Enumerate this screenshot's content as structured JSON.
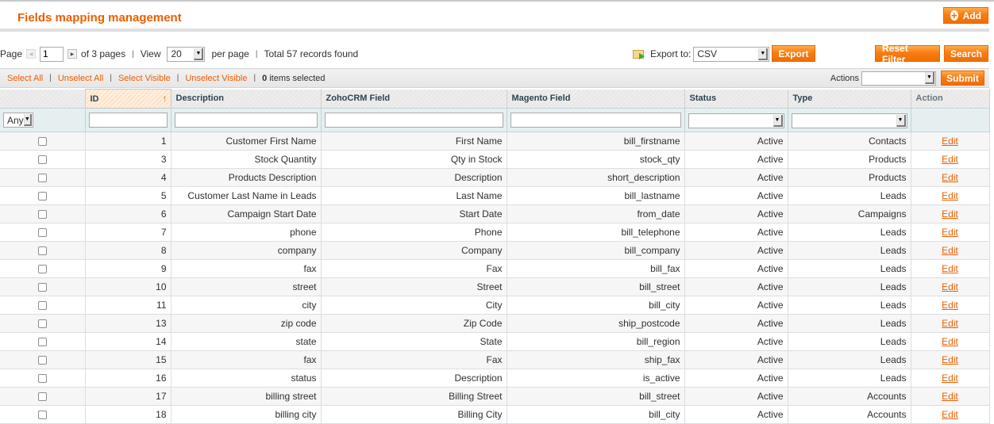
{
  "header": {
    "title": "Fields mapping management",
    "add_label": "Add"
  },
  "pager": {
    "page_label": "Page",
    "current_page": "1",
    "of_pages": "of 3 pages",
    "view_label": "View",
    "per_page_value": "20",
    "per_page_label": "per page",
    "total": "Total 57 records found"
  },
  "export": {
    "label": "Export to:",
    "format": "CSV",
    "button": "Export"
  },
  "filters": {
    "reset_label": "Reset Filter",
    "search_label": "Search"
  },
  "massaction": {
    "select_all": "Select All",
    "unselect_all": "Unselect All",
    "select_visible": "Select Visible",
    "unselect_visible": "Unselect Visible",
    "count": "0",
    "selected_text": "items selected",
    "actions_label": "Actions",
    "actions_value": "",
    "submit_label": "Submit"
  },
  "grid": {
    "columns": [
      "ID",
      "Description",
      "ZohoCRM Field",
      "Magento Field",
      "Status",
      "Type",
      "Action"
    ],
    "checkbox_filter": "Any",
    "rows": [
      {
        "id": "1",
        "description": "Customer First Name",
        "zoho": "First Name",
        "magento": "bill_firstname",
        "status": "Active",
        "type": "Contacts",
        "action": "Edit"
      },
      {
        "id": "3",
        "description": "Stock Quantity",
        "zoho": "Qty in Stock",
        "magento": "stock_qty",
        "status": "Active",
        "type": "Products",
        "action": "Edit"
      },
      {
        "id": "4",
        "description": "Products Description",
        "zoho": "Description",
        "magento": "short_description",
        "status": "Active",
        "type": "Products",
        "action": "Edit"
      },
      {
        "id": "5",
        "description": "Customer Last Name in Leads",
        "zoho": "Last Name",
        "magento": "bill_lastname",
        "status": "Active",
        "type": "Leads",
        "action": "Edit"
      },
      {
        "id": "6",
        "description": "Campaign Start Date",
        "zoho": "Start Date",
        "magento": "from_date",
        "status": "Active",
        "type": "Campaigns",
        "action": "Edit"
      },
      {
        "id": "7",
        "description": "phone",
        "zoho": "Phone",
        "magento": "bill_telephone",
        "status": "Active",
        "type": "Leads",
        "action": "Edit"
      },
      {
        "id": "8",
        "description": "company",
        "zoho": "Company",
        "magento": "bill_company",
        "status": "Active",
        "type": "Leads",
        "action": "Edit"
      },
      {
        "id": "9",
        "description": "fax",
        "zoho": "Fax",
        "magento": "bill_fax",
        "status": "Active",
        "type": "Leads",
        "action": "Edit"
      },
      {
        "id": "10",
        "description": "street",
        "zoho": "Street",
        "magento": "bill_street",
        "status": "Active",
        "type": "Leads",
        "action": "Edit"
      },
      {
        "id": "11",
        "description": "city",
        "zoho": "City",
        "magento": "bill_city",
        "status": "Active",
        "type": "Leads",
        "action": "Edit"
      },
      {
        "id": "13",
        "description": "zip code",
        "zoho": "Zip Code",
        "magento": "ship_postcode",
        "status": "Active",
        "type": "Leads",
        "action": "Edit"
      },
      {
        "id": "14",
        "description": "state",
        "zoho": "State",
        "magento": "bill_region",
        "status": "Active",
        "type": "Leads",
        "action": "Edit"
      },
      {
        "id": "15",
        "description": "fax",
        "zoho": "Fax",
        "magento": "ship_fax",
        "status": "Active",
        "type": "Leads",
        "action": "Edit"
      },
      {
        "id": "16",
        "description": "status",
        "zoho": "Description",
        "magento": "is_active",
        "status": "Active",
        "type": "Leads",
        "action": "Edit"
      },
      {
        "id": "17",
        "description": "billing street",
        "zoho": "Billing Street",
        "magento": "bill_street",
        "status": "Active",
        "type": "Accounts",
        "action": "Edit"
      },
      {
        "id": "18",
        "description": "billing city",
        "zoho": "Billing City",
        "magento": "bill_city",
        "status": "Active",
        "type": "Accounts",
        "action": "Edit"
      }
    ]
  },
  "colors": {
    "accent": "#eb5e00",
    "button": "#f77c16"
  }
}
